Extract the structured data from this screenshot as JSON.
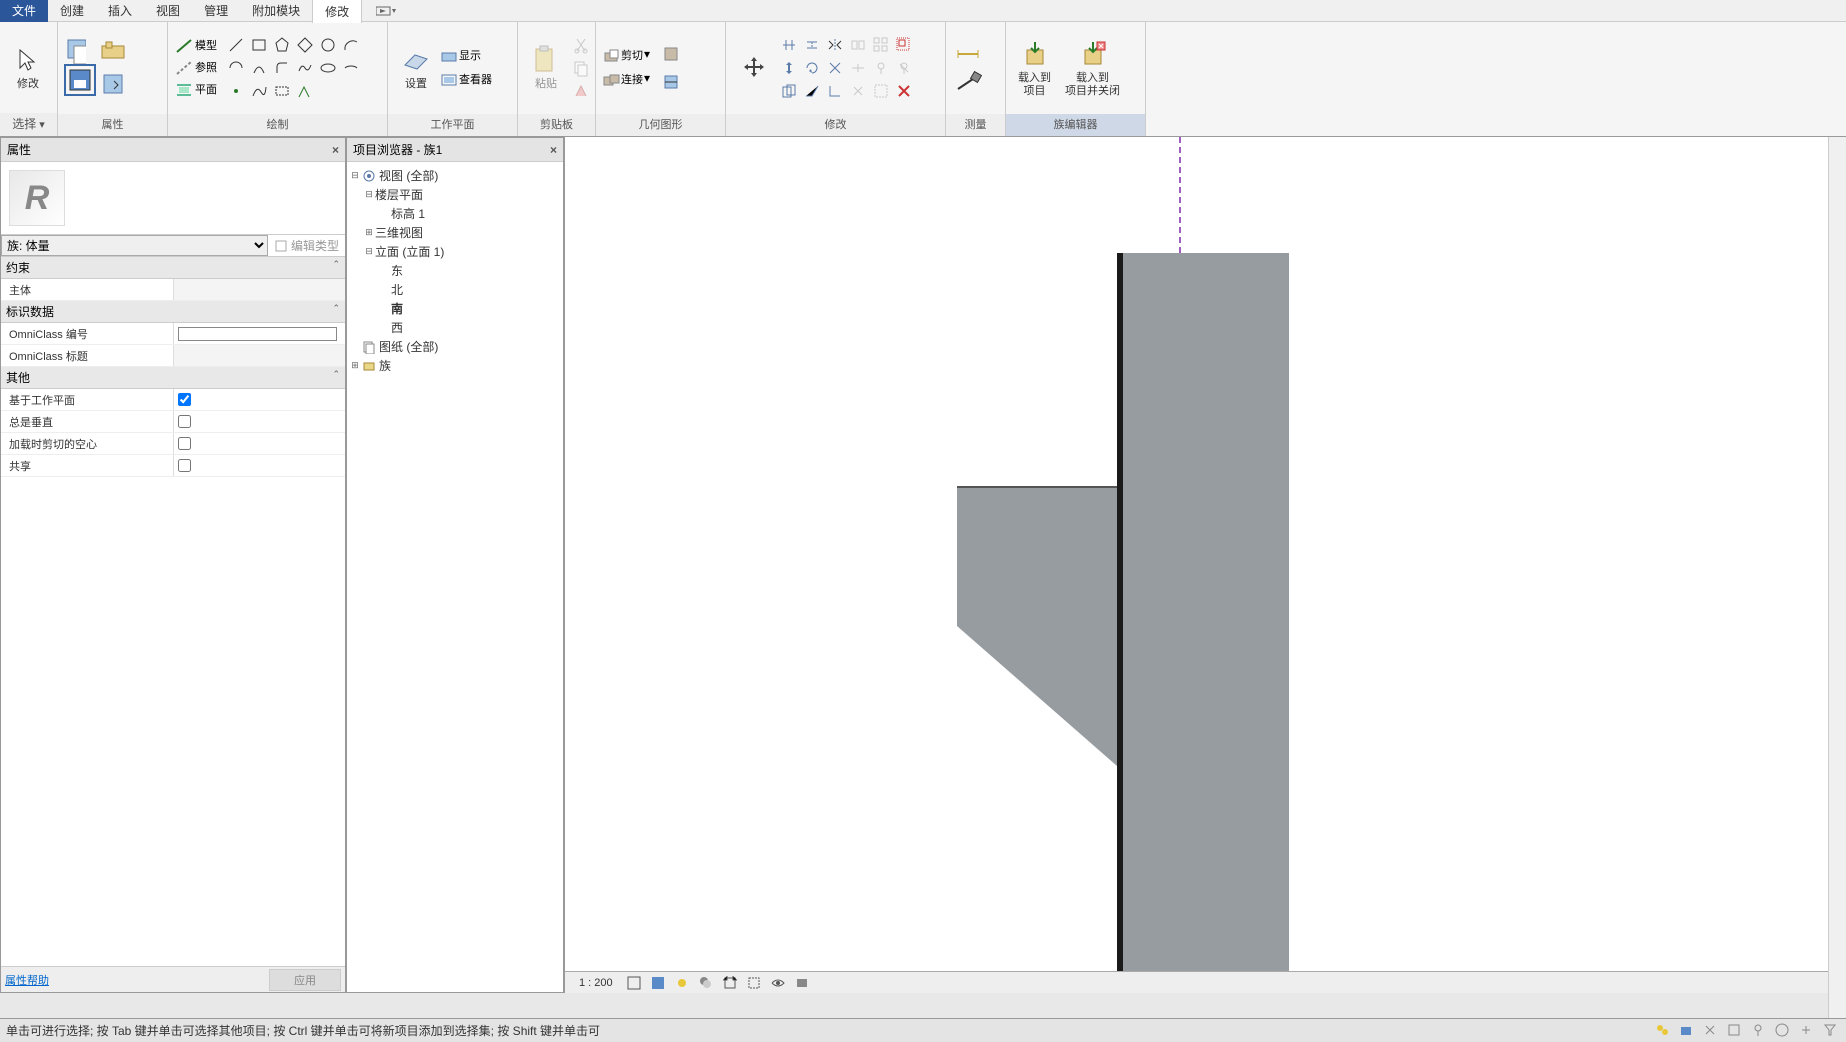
{
  "menu": {
    "file": "文件",
    "items": [
      "创建",
      "插入",
      "视图",
      "管理",
      "附加模块",
      "修改"
    ],
    "active": "修改"
  },
  "ribbon": {
    "select": {
      "modify": "修改",
      "grouplabel": "选择"
    },
    "properties": "属性",
    "draw": {
      "model": "模型",
      "reference": "参照",
      "plane": "平面",
      "grouplabel": "绘制"
    },
    "workplane": {
      "set": "设置",
      "show": "显示",
      "viewer": "查看器",
      "grouplabel": "工作平面"
    },
    "clipboard": {
      "paste": "粘贴",
      "grouplabel": "剪贴板"
    },
    "geometry": {
      "cut": "剪切",
      "join": "连接",
      "grouplabel": "几何图形"
    },
    "modify": {
      "grouplabel": "修改"
    },
    "measure": {
      "grouplabel": "测量"
    },
    "editor": {
      "load": "载入到\n项目",
      "loadclose": "载入到\n项目并关闭",
      "grouplabel": "族编辑器"
    }
  },
  "props": {
    "title": "属性",
    "family_type": "族: 体量",
    "edit_type": "编辑类型",
    "groups": {
      "constraints": "约束",
      "identity": "标识数据",
      "other": "其他"
    },
    "rows": {
      "host": "主体",
      "omniclass_num": "OmniClass 编号",
      "omniclass_num_val": "",
      "omniclass_title": "OmniClass 标题",
      "workplane_based": "基于工作平面",
      "always_vertical": "总是垂直",
      "cut_with_voids": "加载时剪切的空心",
      "shared": "共享"
    },
    "checks": {
      "workplane_based": true,
      "always_vertical": false,
      "cut_with_voids": false,
      "shared": false
    },
    "help": "属性帮助",
    "apply": "应用"
  },
  "browser": {
    "title": "项目浏览器 - 族1",
    "nodes": {
      "views": "视图 (全部)",
      "floorplans": "楼层平面",
      "level1": "标高 1",
      "threed": "三维视图",
      "elev": "立面 (立面 1)",
      "east": "东",
      "north": "北",
      "south": "南",
      "west": "西",
      "sheets": "图纸 (全部)",
      "families": "族"
    }
  },
  "viewbar": {
    "scale": "1 : 200"
  },
  "status": {
    "hint": "单击可进行选择; 按 Tab 键并单击可选择其他项目; 按 Ctrl 键并单击可将新项目添加到选择集; 按 Shift 键并单击可"
  }
}
